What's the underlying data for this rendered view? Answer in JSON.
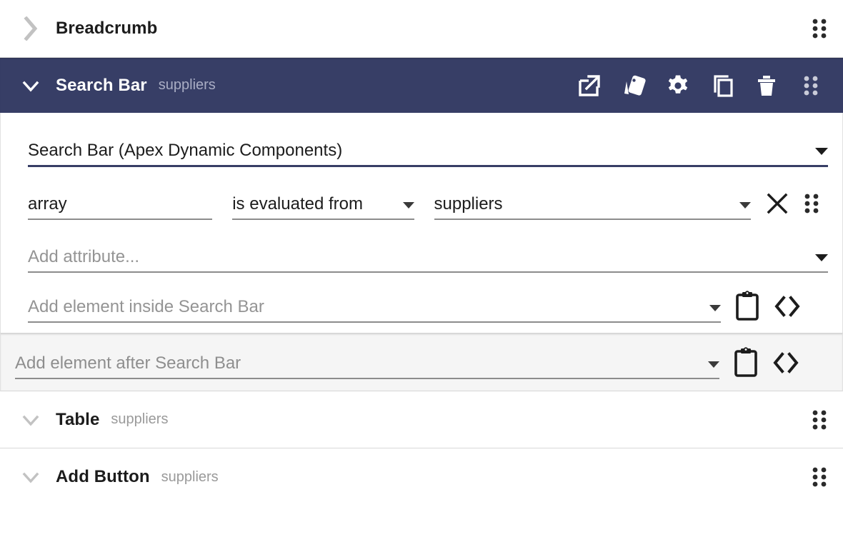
{
  "theme": {
    "selected_header_bg": "#373e66",
    "accent": "#373e66",
    "band_bg": "#f5f5f5",
    "title_color": "#1c1c1c",
    "subtitle_color": "#9a9a9a",
    "placeholder_color": "#949494"
  },
  "rows": {
    "breadcrumb": {
      "title": "Breadcrumb",
      "subtitle": "",
      "chevron": "chevron-right-icon",
      "drag": "drag-handle-icon"
    },
    "table": {
      "title": "Table",
      "subtitle": "suppliers",
      "chevron": "chevron-down-icon",
      "drag": "drag-handle-icon"
    },
    "add_button": {
      "title": "Add Button",
      "subtitle": "suppliers",
      "chevron": "chevron-down-icon",
      "drag": "drag-handle-icon"
    }
  },
  "selected": {
    "title": "Search Bar",
    "subtitle": "suppliers",
    "chevron": "chevron-down-icon",
    "toolbar": [
      {
        "name": "open-external-icon",
        "label": "Open in new window"
      },
      {
        "name": "style-palette-icon",
        "label": "Styles"
      },
      {
        "name": "gear-icon",
        "label": "Settings"
      },
      {
        "name": "copy-icon",
        "label": "Duplicate"
      },
      {
        "name": "trash-icon",
        "label": "Delete"
      },
      {
        "name": "drag-handle-icon",
        "label": "Drag"
      }
    ],
    "component_type": {
      "value": "Search Bar (Apex Dynamic Components)",
      "caret": "chevron-down-icon"
    },
    "attribute": {
      "name": "array",
      "operator": "is evaluated from",
      "value": "suppliers",
      "clear_icon": "close-x-icon",
      "drag_icon": "drag-handle-icon"
    },
    "add_attribute": {
      "placeholder": "Add attribute...",
      "caret": "chevron-down-icon"
    },
    "add_element_inside": {
      "placeholder": "Add element inside Search Bar",
      "caret": "chevron-down-icon",
      "paste_icon": "clipboard-paste-icon",
      "code_icon": "code-brackets-icon"
    }
  },
  "add_element_after": {
    "placeholder": "Add element after Search Bar",
    "caret": "chevron-down-icon",
    "paste_icon": "clipboard-paste-icon",
    "code_icon": "code-brackets-icon"
  }
}
